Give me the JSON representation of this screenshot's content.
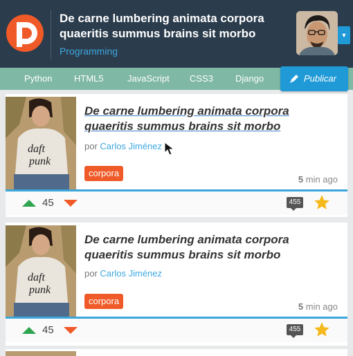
{
  "header": {
    "title": "De carne lumbering animata corpora quaeritis summus brains sit morbo",
    "category": "Programming"
  },
  "nav": {
    "items": [
      "Python",
      "HTML5",
      "JavaScript",
      "CSS3",
      "Django"
    ],
    "publish_label": "Publicar"
  },
  "posts": [
    {
      "title": "De carne lumbering animata corpora quaeritis summus brains sit morbo",
      "by_prefix": "por",
      "author": "Carlos Jiménez",
      "tag": "corpora",
      "time_num": "5",
      "time_unit": "min ago",
      "votes": "45",
      "comments": "455"
    },
    {
      "title": "De carne lumbering animata corpora quaeritis summus brains sit morbo",
      "by_prefix": "por",
      "author": "Carlos Jiménez",
      "tag": "corpora",
      "time_num": "5",
      "time_unit": "min ago",
      "votes": "45",
      "comments": "455"
    }
  ],
  "colors": {
    "header_bg": "#2b3c4c",
    "nav_bg": "#7fb8a4",
    "accent_blue": "#1f9ad6",
    "tag_orange": "#ef5a28",
    "upvote_green": "#2ea44f",
    "star_gold": "#f5b91e"
  },
  "icons": {
    "logo": "brand-d-logo-icon",
    "publish": "pen-icon",
    "upvote": "arrow-up-icon",
    "downvote": "arrow-down-icon",
    "comments": "speech-bubble-icon",
    "favorite": "star-icon"
  }
}
